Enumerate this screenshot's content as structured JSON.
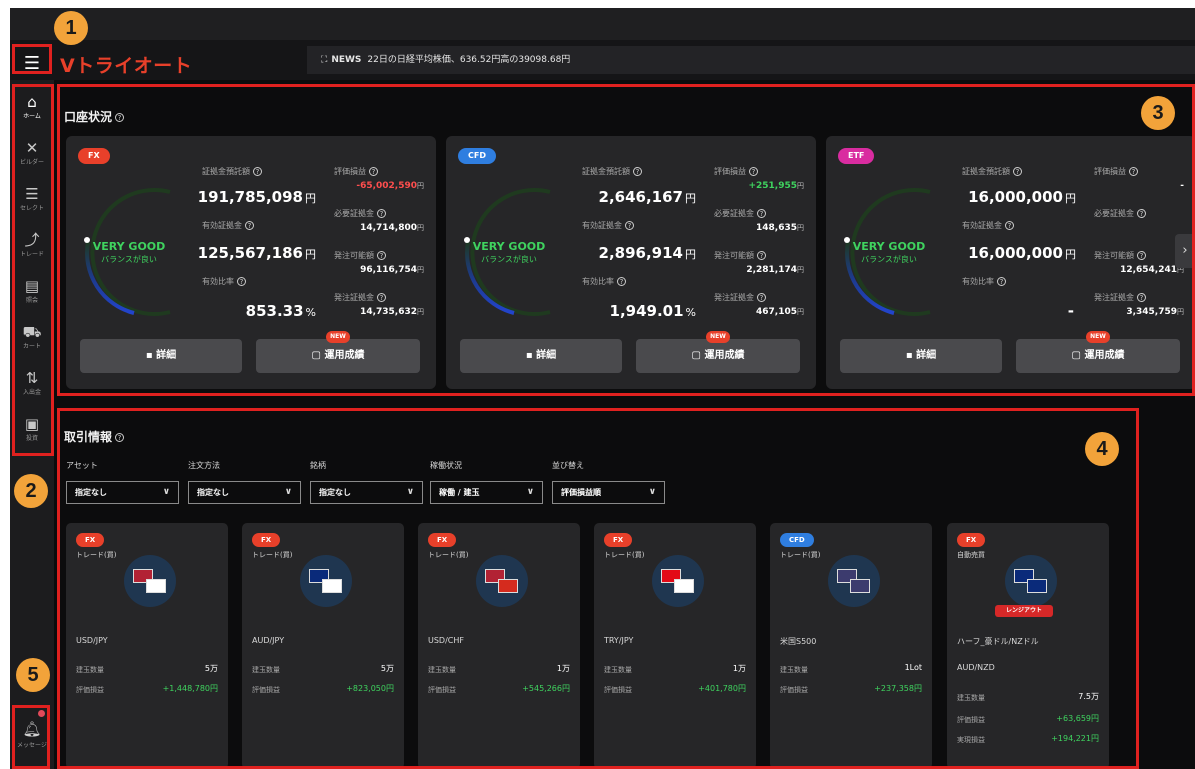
{
  "header": {
    "logo": "Vトライオート",
    "news_tag": "NEWS",
    "news_text": "22日の日経平均株価、636.52円高の39098.68円",
    "menu_icon": "hamburger-icon"
  },
  "sidebar": {
    "items": [
      {
        "label": "ホーム",
        "icon": "home-icon"
      },
      {
        "label": "ビルダー",
        "icon": "tools-icon"
      },
      {
        "label": "セレクト",
        "icon": "select-icon"
      },
      {
        "label": "トレード",
        "icon": "trade-icon"
      },
      {
        "label": "照会",
        "icon": "report-icon"
      },
      {
        "label": "カート",
        "icon": "cart-icon"
      },
      {
        "label": "入出金",
        "icon": "transfer-icon"
      },
      {
        "label": "投資",
        "icon": "lock-icon"
      }
    ],
    "message_label": "メッセージ"
  },
  "account": {
    "title": "口座状況",
    "cards": [
      {
        "tag": "FX",
        "tag_color": "#e8402a",
        "status": "VERY GOOD",
        "status_sub": "バランスが良い",
        "margin_deposit_label": "証拠金預託額",
        "margin_deposit": "191,785,098",
        "unit_yen": "円",
        "effective_margin_label": "有効証拠金",
        "effective_margin": "125,567,186",
        "ratio_label": "有効比率",
        "ratio": "853.33",
        "unit_pct": "%",
        "pl_label": "評価損益",
        "pl": "-65,002,590",
        "required_label": "必要証拠金",
        "required": "14,714,800",
        "order_label": "発注可能額",
        "order": "96,116,754",
        "order_margin_label": "発注証拠金",
        "order_margin": "14,735,632",
        "detail_label": "詳細",
        "perf_label": "運用成績",
        "new_badge": "NEW"
      },
      {
        "tag": "CFD",
        "tag_color": "#2f7ee0",
        "status": "VERY GOOD",
        "status_sub": "バランスが良い",
        "margin_deposit_label": "証拠金預託額",
        "margin_deposit": "2,646,167",
        "unit_yen": "円",
        "effective_margin_label": "有効証拠金",
        "effective_margin": "2,896,914",
        "ratio_label": "有効比率",
        "ratio": "1,949.01",
        "unit_pct": "%",
        "pl_label": "評価損益",
        "pl": "+251,955",
        "required_label": "必要証拠金",
        "required": "148,635",
        "order_label": "発注可能額",
        "order": "2,281,174",
        "order_margin_label": "発注証拠金",
        "order_margin": "467,105",
        "detail_label": "詳細",
        "perf_label": "運用成績",
        "new_badge": "NEW"
      },
      {
        "tag": "ETF",
        "tag_color": "#d92ca0",
        "status": "VERY GOOD",
        "status_sub": "バランスが良い",
        "margin_deposit_label": "証拠金預託額",
        "margin_deposit": "16,000,000",
        "unit_yen": "円",
        "effective_margin_label": "有効証拠金",
        "effective_margin": "16,000,000",
        "ratio_label": "有効比率",
        "ratio": "-",
        "unit_pct": "",
        "pl_label": "評価損益",
        "pl": "-",
        "required_label": "必要証拠金",
        "required": "",
        "order_label": "発注可能額",
        "order": "12,654,241",
        "order_margin_label": "発注証拠金",
        "order_margin": "3,345,759",
        "detail_label": "詳細",
        "perf_label": "運用成績",
        "new_badge": "NEW"
      }
    ]
  },
  "trade": {
    "title": "取引情報",
    "filters": [
      {
        "label": "アセット",
        "value": "指定なし"
      },
      {
        "label": "注文方法",
        "value": "指定なし"
      },
      {
        "label": "銘柄",
        "value": "指定なし"
      },
      {
        "label": "稼働状況",
        "value": "稼働 / 建玉"
      },
      {
        "label": "並び替え",
        "value": "評価損益順"
      }
    ],
    "positions": [
      {
        "tag": "FX",
        "tag_color": "#e8402a",
        "type": "トレード(買)",
        "name": "USD/JPY",
        "qty_label": "建玉数量",
        "qty": "5万",
        "pl_label": "評価損益",
        "pl": "+1,448,780円"
      },
      {
        "tag": "FX",
        "tag_color": "#e8402a",
        "type": "トレード(買)",
        "name": "AUD/JPY",
        "qty_label": "建玉数量",
        "qty": "5万",
        "pl_label": "評価損益",
        "pl": "+823,050円"
      },
      {
        "tag": "FX",
        "tag_color": "#e8402a",
        "type": "トレード(買)",
        "name": "USD/CHF",
        "qty_label": "建玉数量",
        "qty": "1万",
        "pl_label": "評価損益",
        "pl": "+545,266円"
      },
      {
        "tag": "FX",
        "tag_color": "#e8402a",
        "type": "トレード(買)",
        "name": "TRY/JPY",
        "qty_label": "建玉数量",
        "qty": "1万",
        "pl_label": "評価損益",
        "pl": "+401,780円"
      },
      {
        "tag": "CFD",
        "tag_color": "#2f7ee0",
        "type": "トレード(買)",
        "name": "米国S500",
        "qty_label": "建玉数量",
        "qty": "1Lot",
        "pl_label": "評価損益",
        "pl": "+237,358円"
      },
      {
        "tag": "FX",
        "tag_color": "#e8402a",
        "type": "自動売買",
        "name": "ハーフ_豪ドル/NZドル",
        "sub": "AUD/NZD",
        "range_badge": "レンジアウト",
        "qty_label": "建玉数量",
        "qty": "7.5万",
        "pl_label": "評価損益",
        "pl": "+63,659円",
        "realized_label": "実現損益",
        "realized": "+194,221円"
      }
    ]
  },
  "annotations": [
    "1",
    "2",
    "3",
    "4",
    "5"
  ]
}
